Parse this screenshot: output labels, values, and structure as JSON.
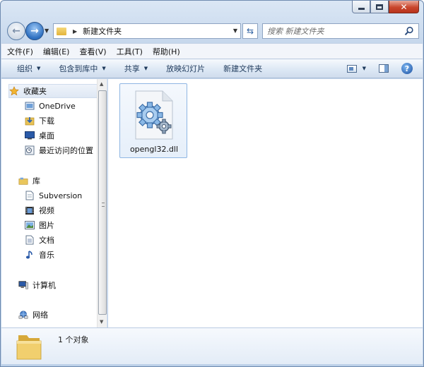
{
  "window": {
    "caption_min": "minimize",
    "caption_max": "maximize",
    "caption_close": "close"
  },
  "address": {
    "path": "新建文件夹"
  },
  "search": {
    "placeholder": "搜索 新建文件夹"
  },
  "menu": {
    "file": "文件(F)",
    "edit": "编辑(E)",
    "view": "查看(V)",
    "tools": "工具(T)",
    "help": "帮助(H)"
  },
  "toolbar": {
    "organize": "组织",
    "include_in_library": "包含到库中",
    "share": "共享",
    "slideshow": "放映幻灯片",
    "new_folder": "新建文件夹"
  },
  "nav": {
    "favorites": "收藏夹",
    "onedrive": "OneDrive",
    "downloads": "下载",
    "desktop": "桌面",
    "recent": "最近访问的位置",
    "libraries": "库",
    "subversion": "Subversion",
    "videos": "视频",
    "pictures": "图片",
    "documents": "文档",
    "music": "音乐",
    "computer": "计算机",
    "network": "网络"
  },
  "files": [
    {
      "name": "opengl32.dll",
      "icon": "dll-gear-icon"
    }
  ],
  "details": {
    "count": "1 个对象"
  },
  "colors": {
    "frame": "#c6d7ec",
    "accent": "#2d6fc0",
    "selection": "#e6effa",
    "close": "#c9462c"
  }
}
